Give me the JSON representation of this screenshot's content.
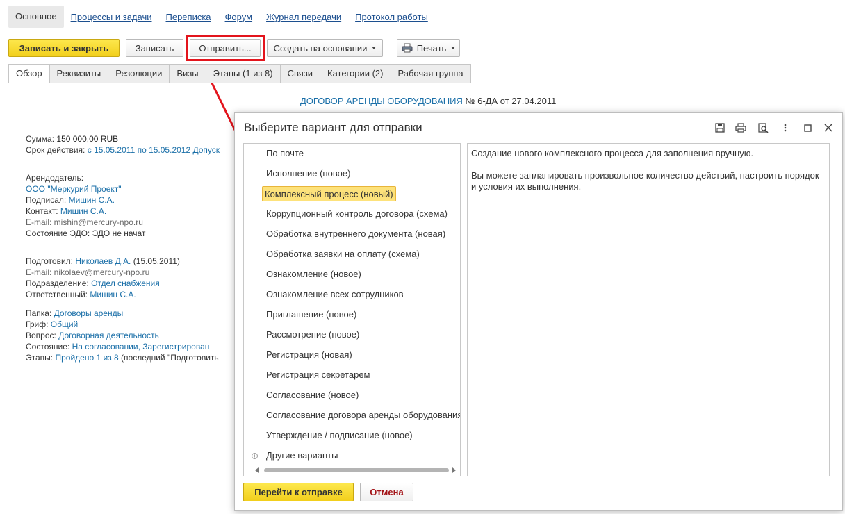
{
  "nav": {
    "items": [
      "Основное",
      "Процессы и задачи",
      "Переписка",
      "Форум",
      "Журнал передачи",
      "Протокол работы"
    ]
  },
  "toolbar": {
    "save_close": "Записать и закрыть",
    "save": "Записать",
    "send": "Отправить...",
    "create_based": "Создать на основании",
    "print": "Печать"
  },
  "tabs": [
    "Обзор",
    "Реквизиты",
    "Резолюции",
    "Визы",
    "Этапы (1 из 8)",
    "Связи",
    "Категории (2)",
    "Рабочая группа"
  ],
  "document": {
    "title_link": "ДОГОВОР АРЕНДЫ ОБОРУДОВАНИЯ",
    "title_rest": " № 6-ДА от 27.04.2011",
    "sum_label": "Сумма:",
    "sum_value": "150 000,00 RUB",
    "term_label": "Срок действия:",
    "term_value": "с 15.05.2011 по 15.05.2012 Допуск",
    "landlord_label": "Арендодатель:",
    "landlord_value": "ООО \"Меркурий Проект\"",
    "signed_label": "Подписал:",
    "signed_value": "Мишин С.А.",
    "contact_label": "Контакт:",
    "contact_value": "Мишин С.А.",
    "email1": "E-mail: mishin@mercury-npo.ru",
    "edo_label": "Состояние ЭДО:",
    "edo_value": "ЭДО не начат",
    "prepared_label": "Подготовил:",
    "prepared_value": "Николаев Д.А.",
    "prepared_date": "(15.05.2011)",
    "email2": "E-mail: nikolaev@mercury-npo.ru",
    "dept_label": "Подразделение:",
    "dept_value": "Отдел снабжения",
    "resp_label": "Ответственный:",
    "resp_value": "Мишин С.А.",
    "folder_label": "Папка:",
    "folder_value": "Договоры аренды",
    "grif_label": "Гриф:",
    "grif_value": "Общий",
    "question_label": "Вопрос:",
    "question_value": "Договорная деятельность",
    "state_label": "Состояние:",
    "state_value": "На согласовании, Зарегистрирован",
    "stages_label": "Этапы:",
    "stages_value": "Пройдено 1 из 8",
    "stages_rest": " (последний \"Подготовить"
  },
  "modal": {
    "title": "Выберите вариант для отправки",
    "options": [
      "По почте",
      "Исполнение (новое)",
      "Комплексный процесс (новый)",
      "Коррупционный контроль договора (схема)",
      "Обработка внутреннего документа (новая)",
      "Обработка заявки на оплату (схема)",
      "Ознакомление (новое)",
      "Ознакомление всех сотрудников",
      "Приглашение (новое)",
      "Рассмотрение (новое)",
      "Регистрация (новая)",
      "Регистрация секретарем",
      "Согласование (новое)",
      "Согласование договора аренды оборудования",
      "Утверждение / подписание (новое)",
      "Другие варианты"
    ],
    "selected_index": 2,
    "description_1": "Создание нового комплексного процесса для заполнения вручную.",
    "description_2": "Вы можете запланировать произвольное количество действий, настроить порядок и условия их выполнения.",
    "go_button": "Перейти к отправке",
    "cancel_button": "Отмена"
  },
  "colors": {
    "accent_yellow": "#f5d526",
    "highlight_red": "#e3141c",
    "link_blue": "#1a6fa8"
  }
}
